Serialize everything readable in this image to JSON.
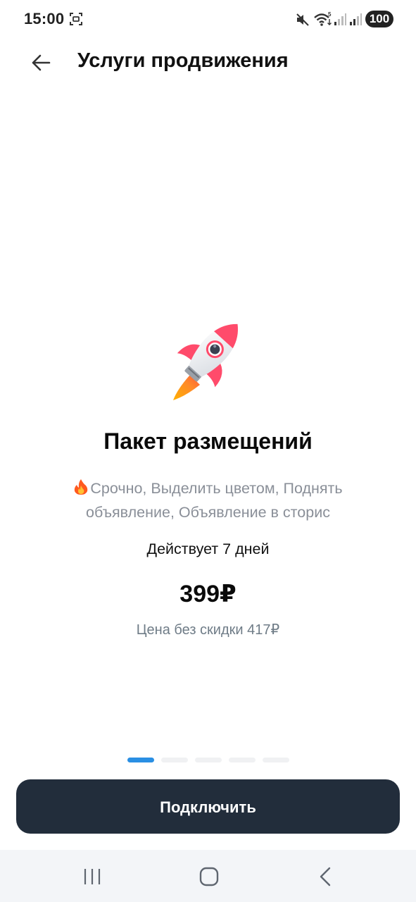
{
  "status_bar": {
    "time": "15:00",
    "battery": "100",
    "icons": [
      "screenshot-icon",
      "mute-icon",
      "wifi-icon",
      "signal-icon",
      "signal-icon",
      "battery-icon"
    ]
  },
  "header": {
    "back_icon": "arrow-left-icon",
    "title": "Услуги продвижения"
  },
  "package": {
    "illustration": "rocket-icon",
    "title": "Пакет размещений",
    "features_icon": "fire-icon",
    "features": "Срочно, Выделить цветом, Поднять объявление, Объявление в сторис",
    "duration": "Действует 7 дней",
    "price": "399₽",
    "old_price": "Цена без скидки 417₽"
  },
  "pager": {
    "count": 5,
    "active_index": 0
  },
  "actions": {
    "connect_label": "Подключить"
  },
  "nav_bar": {
    "icons": [
      "recents-icon",
      "home-icon",
      "back-icon"
    ]
  },
  "colors": {
    "primary_button": "#222d3b",
    "pager_active": "#2a8fe3",
    "pager_inactive": "#f0f1f3",
    "muted_text": "#8a8f98",
    "nav_background": "#f3f5f8"
  }
}
